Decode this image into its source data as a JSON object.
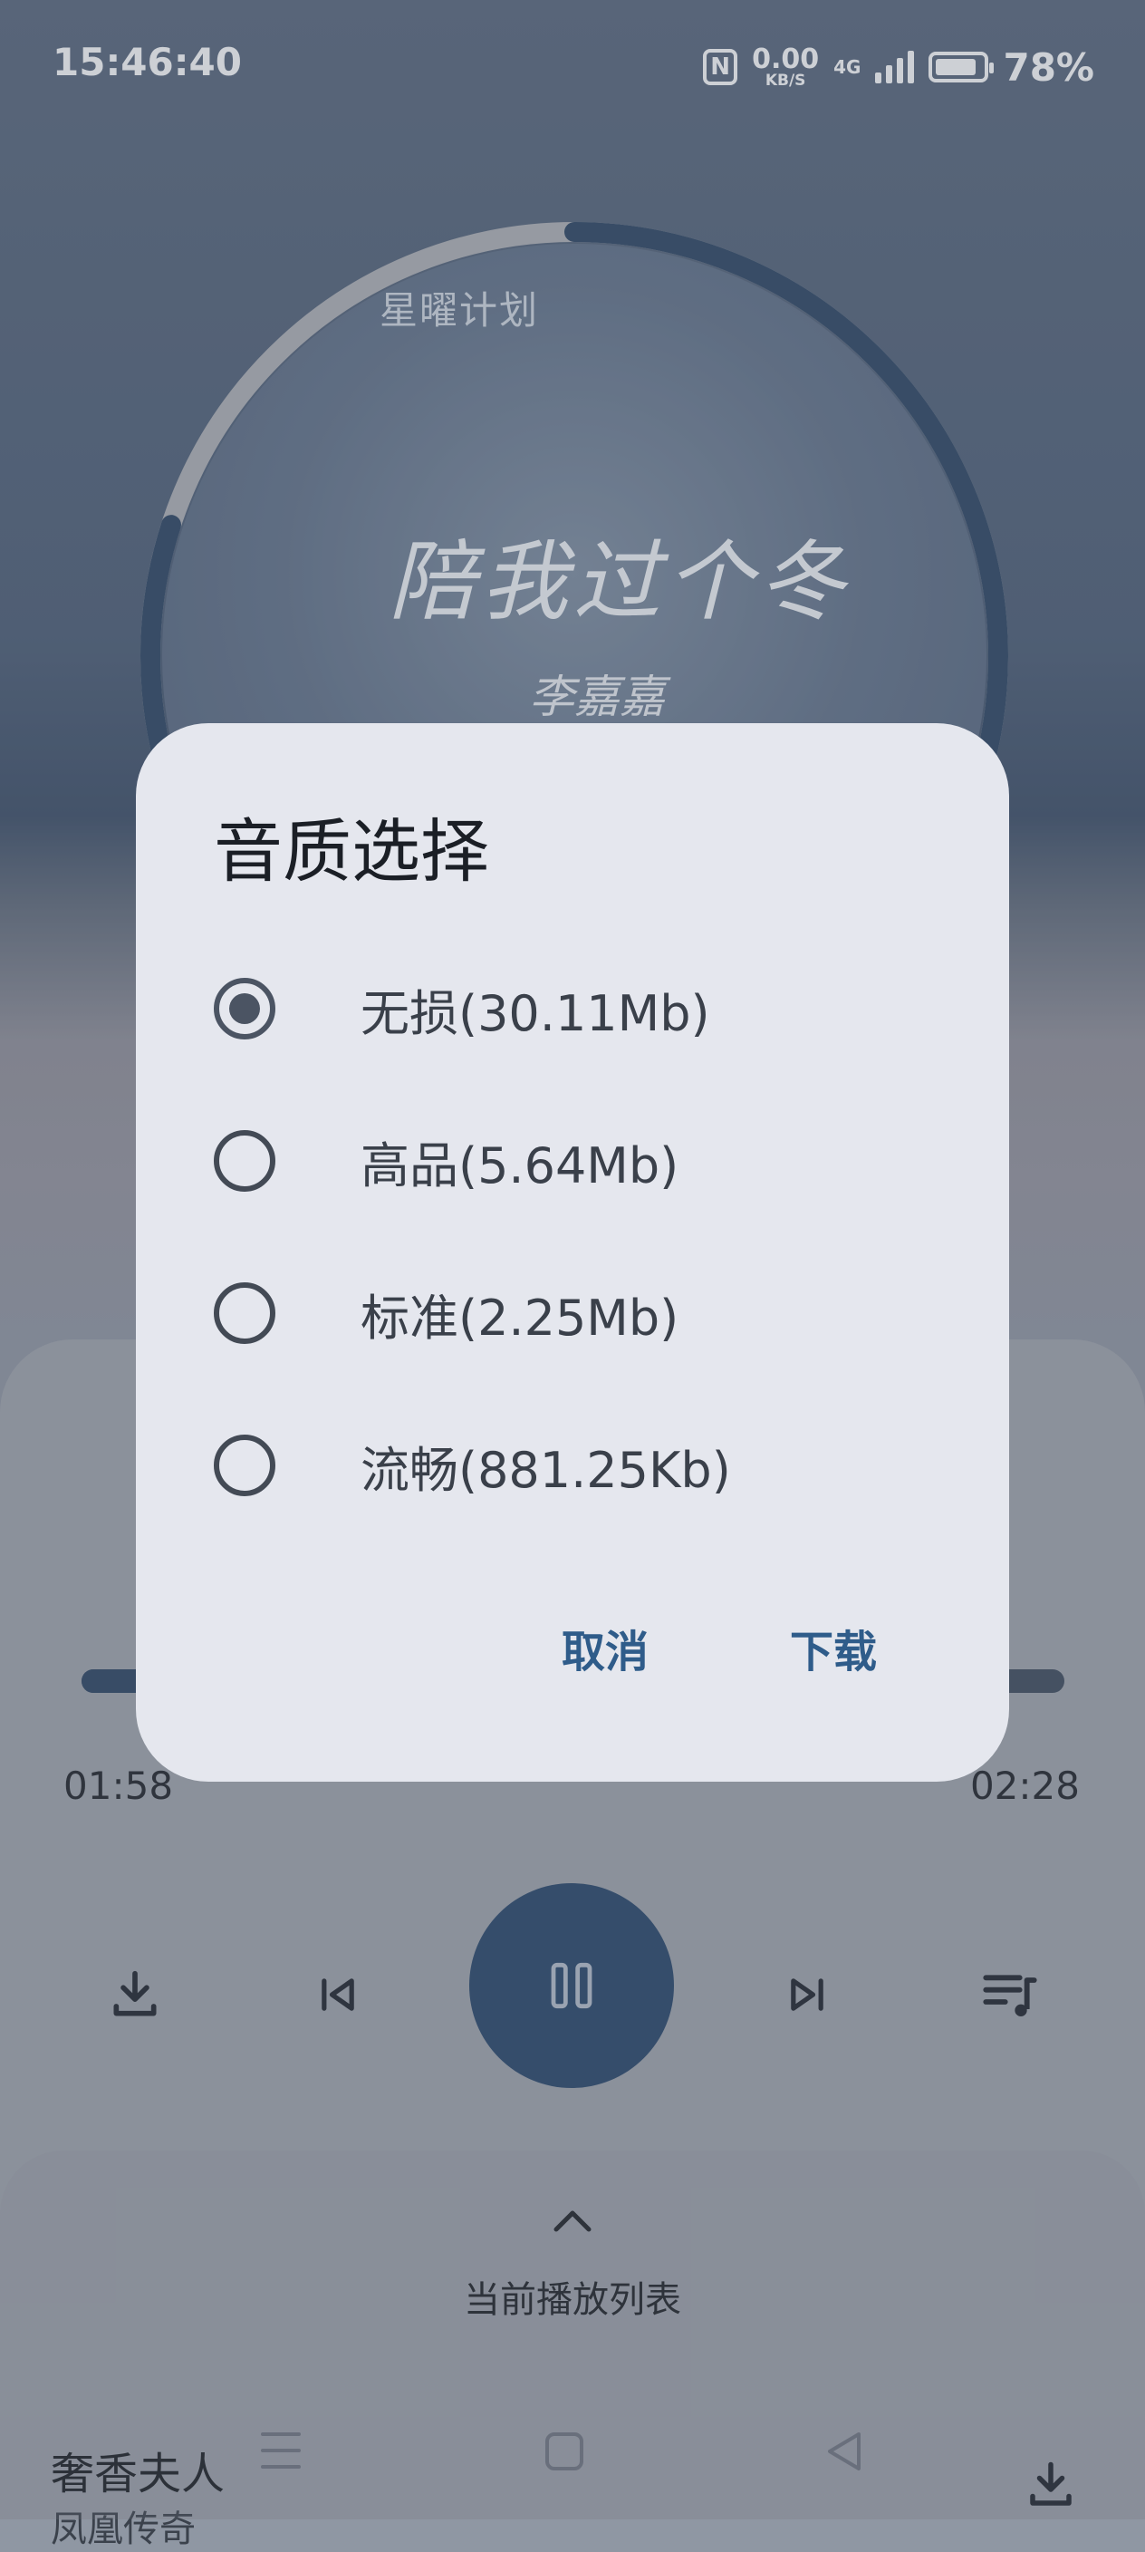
{
  "status_bar": {
    "time": "15:46:40",
    "nfc": "N",
    "speed_value": "0.00",
    "speed_unit": "KB/S",
    "network": "4G",
    "battery": "78%"
  },
  "album_art": {
    "top_text": "星曜计划",
    "title": "陪我过个冬",
    "artist": "李嘉嘉",
    "progress_ring_fraction": 0.8
  },
  "player": {
    "elapsed": "01:58",
    "duration": "02:28",
    "progress_fraction": 0.8
  },
  "playlist_sheet": {
    "label": "当前播放列表",
    "song_title": "奢香夫人",
    "song_artist": "凤凰传奇"
  },
  "dialog": {
    "title": "音质选择",
    "options": [
      {
        "label": "无损(30.11Mb)",
        "selected": true
      },
      {
        "label": "高品(5.64Mb)",
        "selected": false
      },
      {
        "label": "标准(2.25Mb)",
        "selected": false
      },
      {
        "label": "流畅(881.25Kb)",
        "selected": false
      }
    ],
    "cancel": "取消",
    "confirm": "下载"
  },
  "colors": {
    "accent": "#27466a",
    "dialog_bg": "#e5e7ee",
    "button_text": "#2f5c8a"
  },
  "icons": [
    "download-icon",
    "previous-icon",
    "pause-icon",
    "next-icon",
    "playlist-icon",
    "chevron-up-icon",
    "menu-nav-icon",
    "home-nav-icon",
    "back-nav-icon"
  ]
}
